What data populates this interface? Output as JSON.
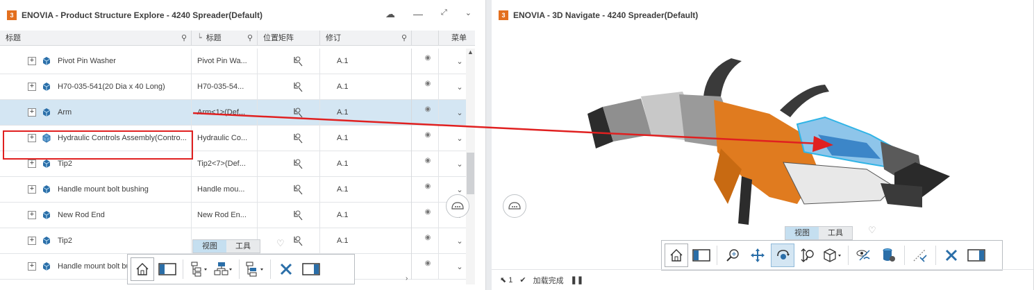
{
  "left_panel": {
    "title": "ENOVIA - Product Structure Explore - 4240 Spreader(Default)",
    "columns": [
      {
        "label": "标题"
      },
      {
        "label": "标题"
      },
      {
        "label": "位置矩阵"
      },
      {
        "label": "修订"
      },
      {
        "label": ""
      },
      {
        "label": "菜单"
      }
    ],
    "rows": [
      {
        "title": "Pivot Pin Washer",
        "instance": "Pivot Pin Wa...",
        "revision": "A.1",
        "selected": false,
        "icon": "part-icon"
      },
      {
        "title": "H70-035-541(20 Dia x 40 Long)",
        "instance": "H70-035-54...",
        "revision": "A.1",
        "selected": false,
        "icon": "part-icon"
      },
      {
        "title": "Arm",
        "instance": "Arm<1>(Def...",
        "revision": "A.1",
        "selected": true,
        "icon": "part-icon"
      },
      {
        "title": "Hydraulic Controls Assembly(Contro...",
        "instance": "Hydraulic Co...",
        "revision": "A.1",
        "selected": false,
        "icon": "assembly-icon"
      },
      {
        "title": "Tip2",
        "instance": "Tip2<7>(Def...",
        "revision": "A.1",
        "selected": false,
        "icon": "part-icon"
      },
      {
        "title": "Handle mount bolt bushing",
        "instance": "Handle mou...",
        "revision": "A.1",
        "selected": false,
        "icon": "part-icon"
      },
      {
        "title": "New Rod End",
        "instance": "New Rod En...",
        "revision": "A.1",
        "selected": false,
        "icon": "part-icon"
      },
      {
        "title": "Tip2",
        "instance": "",
        "revision": "A.1",
        "selected": false,
        "icon": "part-icon"
      },
      {
        "title": "Handle mount bolt bu",
        "instance": "",
        "revision": "",
        "selected": false,
        "icon": "part-icon"
      }
    ],
    "tabs": {
      "view": "视图",
      "tools": "工具"
    }
  },
  "right_panel": {
    "title": "ENOVIA - 3D Navigate - 4240 Spreader(Default)",
    "tabs": {
      "view": "视图",
      "tools": "工具"
    },
    "status": {
      "count": "1",
      "message": "加载完成"
    }
  },
  "colors": {
    "accent": "#e36f1e",
    "selection": "#d4e6f3",
    "highlight": "#e02020",
    "part_blue": "#1a6fb0"
  }
}
